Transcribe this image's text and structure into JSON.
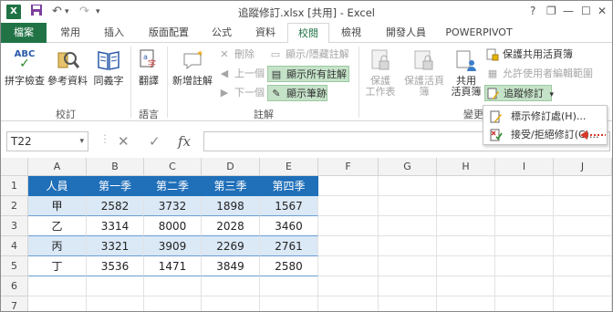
{
  "window": {
    "app_icon_letter": "X",
    "title": "追蹤修訂.xlsx [共用] - Excel",
    "help": "?",
    "restore": "❐",
    "minimize": "—",
    "maximize": "☐",
    "close": "✕"
  },
  "quick_access": {
    "save_glyph": "💾",
    "undo_glyph": "↶",
    "redo_glyph": "↷",
    "more_glyph": "▾"
  },
  "tabs": [
    "檔案",
    "常用",
    "插入",
    "版面配置",
    "公式",
    "資料",
    "校閱",
    "檢視",
    "開發人員",
    "POWERPIVOT"
  ],
  "active_tab": "校閱",
  "ribbon": {
    "proofing": {
      "label": "校訂",
      "spell": "拼字檢查",
      "spell_icon_text": "ABC",
      "research": "參考資料",
      "thesaurus": "同義字"
    },
    "language": {
      "label": "語言",
      "translate": "翻譯"
    },
    "comments": {
      "label": "註解",
      "new_comment": "新增註解",
      "delete": "刪除",
      "previous": "上一個",
      "next": "下一個",
      "show_hide": "顯示/隱藏註解",
      "show_all": "顯示所有註解",
      "show_ink": "顯示筆跡"
    },
    "changes": {
      "label": "變更",
      "protect_sheet_1": "保護",
      "protect_sheet_2": "工作表",
      "protect_workbook": "保護活頁簿",
      "share_1": "共用",
      "share_2": "活頁簿",
      "protect_share": "保護共用活頁簿",
      "allow_edit": "允許使用者編輯範圍",
      "track_changes": "追蹤修訂",
      "track_arrow": "▾"
    }
  },
  "menu": {
    "highlight": "標示修訂處(H)...",
    "accept_reject": "接受/拒絕修訂(C)...",
    "arrow_glyph": "⇠"
  },
  "formula_bar": {
    "name_box": "T22",
    "name_arrow": "▾",
    "cancel": "✕",
    "enter": "✓",
    "fx": "fx",
    "formula": ""
  },
  "sheet": {
    "columns": [
      "A",
      "B",
      "C",
      "D",
      "E",
      "F",
      "G",
      "H",
      "I",
      "J"
    ],
    "rows": [
      "1",
      "2",
      "3",
      "4",
      "5",
      "6",
      "7"
    ],
    "header_row": [
      "人員",
      "第一季",
      "第二季",
      "第三季",
      "第四季"
    ],
    "data": [
      [
        "甲",
        "2582",
        "3732",
        "1898",
        "1567"
      ],
      [
        "乙",
        "3314",
        "8000",
        "2028",
        "3460"
      ],
      [
        "丙",
        "3321",
        "3909",
        "2269",
        "2761"
      ],
      [
        "丁",
        "3536",
        "1471",
        "3849",
        "2580"
      ]
    ],
    "table_header_color": "#1f6fb9",
    "table_band_color": "#dbe8f6"
  },
  "colors": {
    "accent": "#217346",
    "highlight": "#c5e3c8",
    "arrow_red": "#d83a2c"
  }
}
